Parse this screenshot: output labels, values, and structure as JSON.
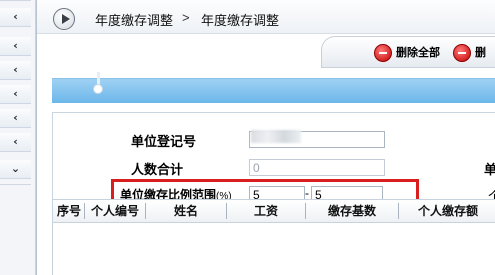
{
  "sidebar": {
    "items": [
      {
        "icon": "chevron-left-icon",
        "glyph": "‹"
      },
      {
        "icon": "chevron-left-icon",
        "glyph": "‹"
      },
      {
        "icon": "chevron-left-icon",
        "glyph": "‹"
      },
      {
        "icon": "chevron-left-icon",
        "glyph": "‹"
      },
      {
        "icon": "chevron-left-icon",
        "glyph": "‹"
      },
      {
        "icon": "chevron-left-icon",
        "glyph": "‹"
      },
      {
        "icon": "chevron-down-icon",
        "glyph": "⌄"
      }
    ]
  },
  "breadcrumb": {
    "items": [
      "年度缴存调整",
      "年度缴存调整"
    ],
    "separator": ">"
  },
  "toolbar": {
    "delete_all_label": "删除全部",
    "delete_label": "删"
  },
  "form": {
    "unit_reg_no_label": "单位登记号",
    "unit_reg_no_value": "",
    "headcount_label": "人数合计",
    "headcount_value": "0",
    "ratio_range_label": "单位缴存比例范围",
    "ratio_range_unit": "(%)",
    "ratio_from": "5",
    "range_sep": "-",
    "ratio_to": "5",
    "right_label_1": "单",
    "right_label_2": "个"
  },
  "table": {
    "columns": [
      "序号",
      "个人编号",
      "姓名",
      "工资",
      "缴存基数",
      "个人缴存额"
    ]
  },
  "colors": {
    "accent_blue": "#6bb6ea",
    "highlight_red": "#d91e1e"
  }
}
